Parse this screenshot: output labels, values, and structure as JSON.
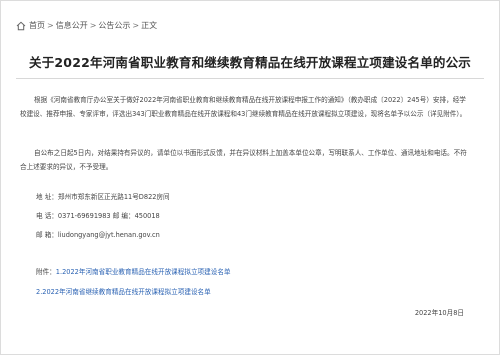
{
  "breadcrumb": {
    "home": "首页",
    "info_open": "信息公开",
    "notice": "公告公示",
    "current": "正文",
    "separator": ">"
  },
  "article": {
    "title": "关于2022年河南省职业教育和继续教育精品在线开放课程立项建设名单的公示",
    "para1": "根据《河南省教育厅办公室关于做好2022年河南省职业教育和继续教育精品在线开放课程申报工作的通知》（教办职成〔2022〕245号）安排，经学校建设、推荐申报、专家评审，评选出343门职业教育精品在线开放课程和43门继续教育精品在线开放课程拟立项建设，现将名单予以公示（详见附件）。",
    "para2": "自公布之日起5日内，对结果持有异议的，请单位以书面形式反馈，并在异议材料上加盖本单位公章，写明联系人、工作单位、通讯地址和电话。不符合上述要求的异议，不予受理。",
    "address": "地 址：郑州市郑东新区正光路11号D822房间",
    "phone": "电 话：0371-69691983 邮 编：450018",
    "email": "邮 箱：liudongyang@jyt.henan.gov.cn",
    "attachments_label": "附件：",
    "attachments": [
      "1.2022年河南省职业教育精品在线开放课程拟立项建设名单",
      "2.2022年河南省继续教育精品在线开放课程拟立项建设名单"
    ],
    "date": "2022年10月8日"
  },
  "colors": {
    "link": "#2a62b3",
    "text": "#444444",
    "title": "#222222"
  },
  "icons": {
    "home": "home-icon"
  }
}
